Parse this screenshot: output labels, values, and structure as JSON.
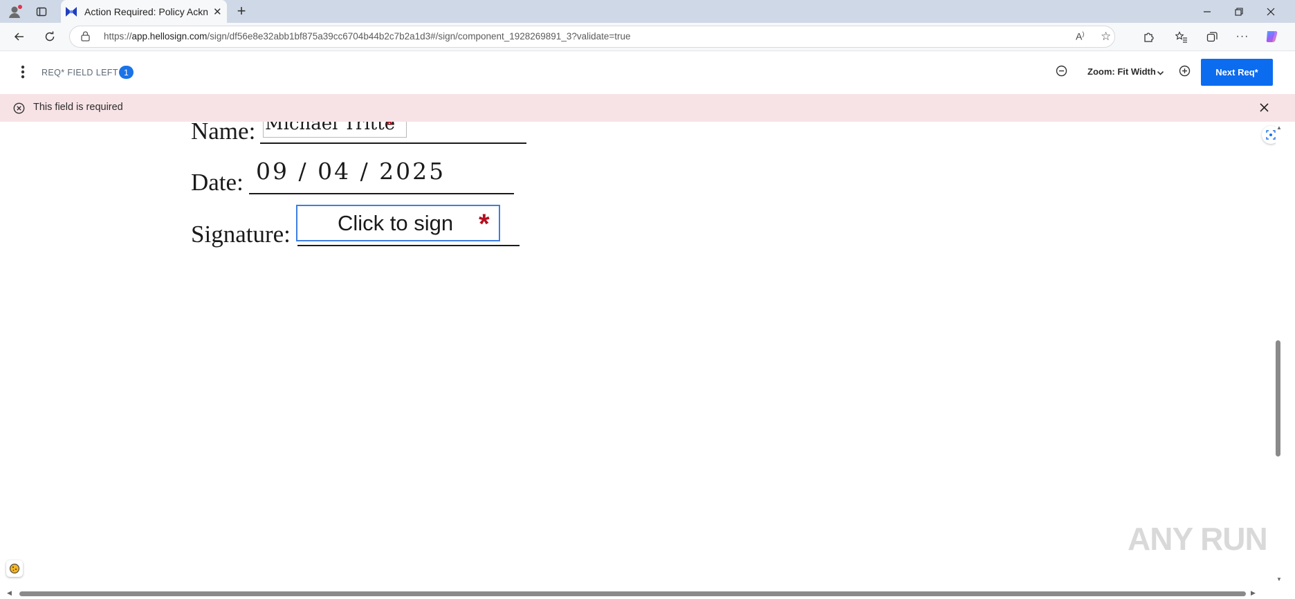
{
  "browser": {
    "tab": {
      "title": "Action Required: Policy Acknowledgement"
    },
    "address": {
      "host": "app.hellosign.com",
      "url_prefix": "https://",
      "url_path": "/sign/df56e8e32abb1bf875a39cc6704b44b2c7b2a1d3#/sign/component_1928269891_3?validate=true"
    },
    "icons": [
      "profile-icon",
      "tab-actions-icon",
      "close-icon",
      "new-tab-icon",
      "back-icon",
      "reload-icon",
      "lock-icon",
      "read-aloud-icon",
      "favorite-icon",
      "extensions-icon",
      "favorites-icon",
      "collections-icon",
      "more-icon",
      "copilot-icon",
      "minimize-icon",
      "restore-icon"
    ]
  },
  "toolbar": {
    "req_label": "REQ* FIELD LEFT",
    "req_count": "1",
    "zoom_label": "Zoom: Fit Width",
    "next_label": "Next Req*"
  },
  "banner": {
    "message": "This field is required"
  },
  "document": {
    "name_label": "Name:",
    "name_value": "Michael Tritte",
    "date_label": "Date:",
    "date_value": "09 / 04 / 2025",
    "signature_label": "Signature:",
    "signature_placeholder": "Click to sign",
    "required_mark": "*"
  },
  "watermark": "ANY RUN",
  "colors": {
    "accent": "#0b6cf0",
    "error_banner": "#f7e3e6",
    "required_star": "#b40f1f",
    "signature_border": "#3d7ee0"
  }
}
